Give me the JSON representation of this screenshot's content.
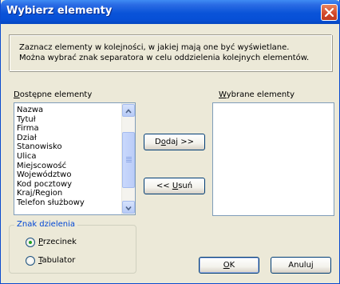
{
  "window": {
    "title": "Wybierz elementy",
    "close_icon": "close-icon"
  },
  "description": {
    "line1": "Zaznacz elementy w kolejności, w jakiej mają one być wyświetlane.",
    "line2": "Można wybrać znak separatora w celu oddzielenia kolejnych elementów."
  },
  "available": {
    "label_first": "D",
    "label_rest": "ostępne elementy",
    "items": [
      "Nazwa",
      "Tytuł",
      "Firma",
      "Dział",
      "Stanowisko",
      "Ulica",
      "Miejscowość",
      "Województwo",
      "Kod pocztowy",
      "Kraj/Region",
      "Telefon służbowy"
    ]
  },
  "selected": {
    "label_first": "W",
    "label_rest": "ybrane elementy",
    "items": []
  },
  "buttons": {
    "add_pre": "D",
    "add_u": "o",
    "add_post": "daj >>",
    "remove_pre": "<< ",
    "remove_u": "U",
    "remove_post": "suń",
    "ok_u": "O",
    "ok_post": "K",
    "cancel": "Anuluj"
  },
  "separator": {
    "title": "Znak dzielenia",
    "options": [
      {
        "u": "P",
        "rest": "rzecinek",
        "selected": true
      },
      {
        "u": "T",
        "rest": "abulator",
        "selected": false
      }
    ]
  }
}
